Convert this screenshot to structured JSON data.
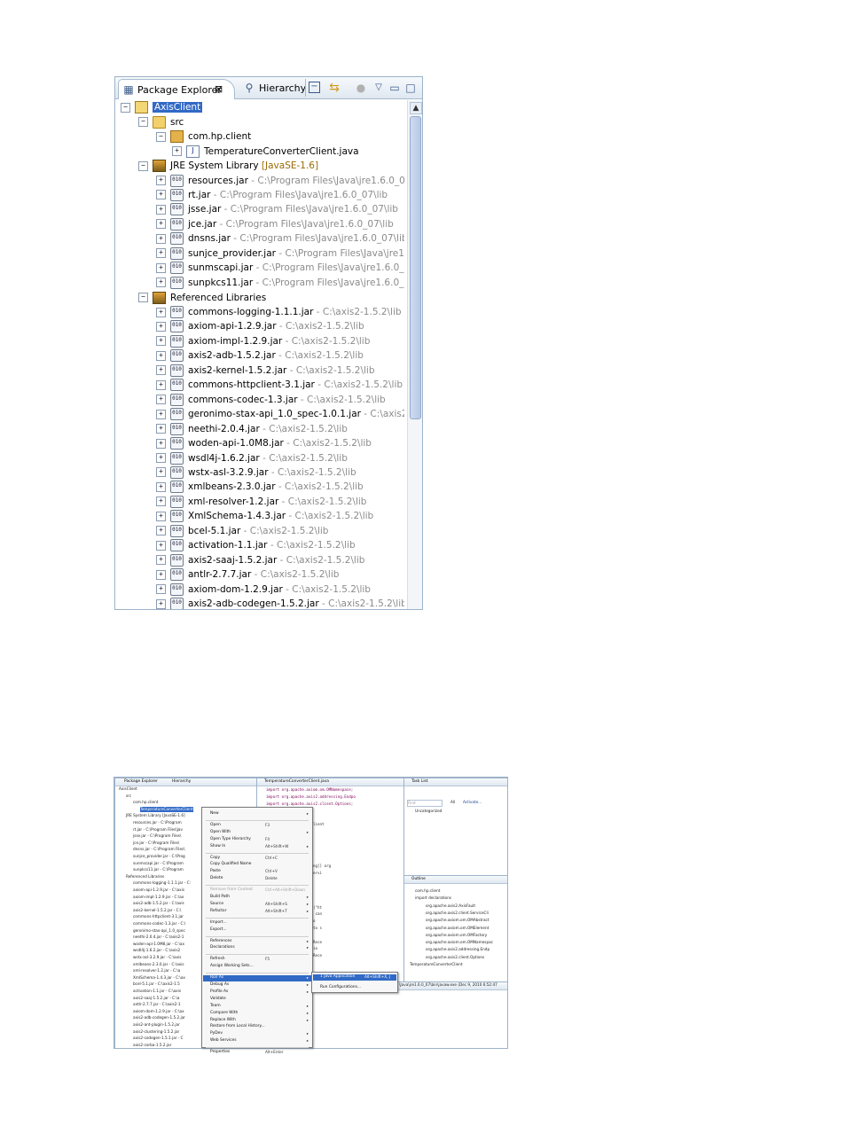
{
  "package_explorer": {
    "tabs": [
      {
        "label": "Package Explorer",
        "close": "⊠"
      },
      {
        "label": "Hierarchy"
      }
    ],
    "tree": {
      "project": "AxisClient",
      "src": "src",
      "package": "com.hp.client",
      "java_file": "TemperatureConverterClient.java",
      "jre_library": {
        "label": "JRE System Library",
        "decoration": "[JavaSE-1.6]"
      },
      "jre_jars": [
        {
          "name": "resources.jar",
          "path": " - C:\\Program Files\\Java\\jre1.6.0_07\\lib"
        },
        {
          "name": "rt.jar",
          "path": " - C:\\Program Files\\Java\\jre1.6.0_07\\lib"
        },
        {
          "name": "jsse.jar",
          "path": " - C:\\Program Files\\Java\\jre1.6.0_07\\lib"
        },
        {
          "name": "jce.jar",
          "path": " - C:\\Program Files\\Java\\jre1.6.0_07\\lib"
        },
        {
          "name": "dnsns.jar",
          "path": " - C:\\Program Files\\Java\\jre1.6.0_07\\lib\\ext"
        },
        {
          "name": "sunjce_provider.jar",
          "path": " - C:\\Program Files\\Java\\jre1.6.0"
        },
        {
          "name": "sunmscapi.jar",
          "path": " - C:\\Program Files\\Java\\jre1.6.0_07\\lib"
        },
        {
          "name": "sunpkcs11.jar",
          "path": " - C:\\Program Files\\Java\\jre1.6.0_07\\lib"
        }
      ],
      "referenced_label": "Referenced Libraries",
      "referenced_jars": [
        {
          "name": "commons-logging-1.1.1.jar",
          "path": " - C:\\axis2-1.5.2\\lib"
        },
        {
          "name": "axiom-api-1.2.9.jar",
          "path": " - C:\\axis2-1.5.2\\lib"
        },
        {
          "name": "axiom-impl-1.2.9.jar",
          "path": " - C:\\axis2-1.5.2\\lib"
        },
        {
          "name": "axis2-adb-1.5.2.jar",
          "path": " - C:\\axis2-1.5.2\\lib"
        },
        {
          "name": "axis2-kernel-1.5.2.jar",
          "path": " - C:\\axis2-1.5.2\\lib"
        },
        {
          "name": "commons-httpclient-3.1.jar",
          "path": " - C:\\axis2-1.5.2\\lib"
        },
        {
          "name": "commons-codec-1.3.jar",
          "path": " - C:\\axis2-1.5.2\\lib"
        },
        {
          "name": "geronimo-stax-api_1.0_spec-1.0.1.jar",
          "path": " - C:\\axis2-1.5"
        },
        {
          "name": "neethi-2.0.4.jar",
          "path": " - C:\\axis2-1.5.2\\lib"
        },
        {
          "name": "woden-api-1.0M8.jar",
          "path": " - C:\\axis2-1.5.2\\lib"
        },
        {
          "name": "wsdl4j-1.6.2.jar",
          "path": " - C:\\axis2-1.5.2\\lib"
        },
        {
          "name": "wstx-asl-3.2.9.jar",
          "path": " - C:\\axis2-1.5.2\\lib"
        },
        {
          "name": "xmlbeans-2.3.0.jar",
          "path": " - C:\\axis2-1.5.2\\lib"
        },
        {
          "name": "xml-resolver-1.2.jar",
          "path": " - C:\\axis2-1.5.2\\lib"
        },
        {
          "name": "XmlSchema-1.4.3.jar",
          "path": " - C:\\axis2-1.5.2\\lib"
        },
        {
          "name": "bcel-5.1.jar",
          "path": " - C:\\axis2-1.5.2\\lib"
        },
        {
          "name": "activation-1.1.jar",
          "path": " - C:\\axis2-1.5.2\\lib"
        },
        {
          "name": "axis2-saaj-1.5.2.jar",
          "path": " - C:\\axis2-1.5.2\\lib"
        },
        {
          "name": "antlr-2.7.7.jar",
          "path": " - C:\\axis2-1.5.2\\lib"
        },
        {
          "name": "axiom-dom-1.2.9.jar",
          "path": " - C:\\axis2-1.5.2\\lib"
        },
        {
          "name": "axis2-adb-codegen-1.5.2.jar",
          "path": " - C:\\axis2-1.5.2\\lib"
        }
      ],
      "jar_badge": "010"
    }
  },
  "workspace": {
    "editor_tab": "TemperatureConverterClient.java",
    "tasklist_tab": "Task List",
    "outline_tab": "Outline",
    "explorer_tab": "Package Explorer",
    "hierarchy_tab": "Hierarchy",
    "code_lines": [
      "import org.apache.axiom.om.OMNamespace;",
      "import org.apache.axis2.addressing.Endpo",
      "import org.apache.axis2.client.Options;",
      "",
      "",
      "TemperatureConverterClient",
      "",
      "",
      "args",
      "AxisFault",
      "",
      "static void main(String[] arg",
      "Client client = new Servi",
      "the option object",
      "g target EPR",
      "opts = new Options();",
      "",
      "new EndpointReference(\"ht",
      "ing action ,and which can",
      "Action(\"urn:fConversio",
      "ing created option into s",
      "setOptions(opts);",
      "nt res1 = client.sendRece",
      "Action(\"urn:fcConversio",
      "nt res2 = client.sendRece",
      "out.println(res1);",
      "out.println(res2);"
    ],
    "tasklist": {
      "find": "Find",
      "all": "All",
      "activate": "Activate...",
      "uncategorized": "Uncategorized"
    },
    "outline_items": [
      "com.hp.client",
      "import declarations",
      "org.apache.axis2.AxisFault",
      "org.apache.axis2.client.ServiceCli",
      "org.apache.axiom.om.OMAbstract",
      "org.apache.axiom.om.OMElement",
      "org.apache.axiom.om.OMFactory",
      "org.apache.axiom.om.OMNamespac",
      "org.apache.axis2.addressing.Endp",
      "org.apache.axis2.client.Options",
      "TemperatureConverterClient"
    ],
    "console_line": "\\Java\\jre1.6.0_07\\bin\\javaw.exe (Dec 9, 2010 6:52:47",
    "mini_tree": {
      "project": "AxisClient",
      "src": "src",
      "package": "com.hp.client",
      "selected": "TemperatureConverterClient",
      "jre": "JRE System Library [JavaSE-1.6]",
      "jre_jars": [
        "resources.jar - C:\\Program",
        "rt.jar - C:\\Program Files\\Jav",
        "jsse.jar - C:\\Program Files\\",
        "jce.jar - C:\\Program Files\\",
        "dnsns.jar - C:\\Program Files\\",
        "sunjce_provider.jar - C:\\Prog",
        "sunmscapi.jar - C:\\Program",
        "sunpkcs11.jar - C:\\Program"
      ],
      "ref": "Referenced Libraries",
      "ref_jars": [
        "commons-logging-1.1.1.jar - C:",
        "axiom-api-1.2.9.jar - C:\\axis",
        "axiom-impl-1.2.9.jar - C:\\ax",
        "axis2-adb-1.5.2.jar - C:\\axis",
        "axis2-kernel-1.5.2.jar - C:\\",
        "commons-httpclient-3.1.jar",
        "commons-codec-1.3.jar - C:\\",
        "geronimo-stax-api_1.0_spec",
        "neethi-2.0.4.jar - C:\\axis2-1",
        "woden-api-1.0M8.jar - C:\\ax",
        "wsdl4j-1.6.2.jar - C:\\axis2",
        "wstx-asl-3.2.9.jar - C:\\axis",
        "xmlbeans-2.3.0.jar - C:\\axis",
        "xml-resolver-1.2.jar - C:\\a",
        "XmlSchema-1.4.3.jar - C:\\ax",
        "bcel-5.1.jar - C:\\axis2-1.5",
        "activation-1.1.jar - C:\\axis",
        "axis2-saaj-1.5.2.jar - C:\\a",
        "antlr-2.7.7.jar - C:\\axis2-1",
        "axiom-dom-1.2.9.jar - C:\\ax",
        "axis2-adb-codegen-1.5.2.jar",
        "axis2-ant-plugin-1.5.2.jar",
        "axis2-clustering-1.5.2.jar",
        "axis2-codegen-1.5.1.jar - C",
        "axis2-corba-1.5.2.jar"
      ]
    },
    "context_menu": [
      {
        "label": "New",
        "submenu": true
      },
      {
        "sep": true
      },
      {
        "label": "Open",
        "shortcut": "F3"
      },
      {
        "label": "Open With",
        "submenu": true
      },
      {
        "label": "Open Type Hierarchy",
        "shortcut": "F4"
      },
      {
        "label": "Show In",
        "shortcut": "Alt+Shift+W",
        "submenu": true
      },
      {
        "sep": true
      },
      {
        "label": "Copy",
        "shortcut": "Ctrl+C"
      },
      {
        "label": "Copy Qualified Name"
      },
      {
        "label": "Paste",
        "shortcut": "Ctrl+V"
      },
      {
        "label": "Delete",
        "shortcut": "Delete"
      },
      {
        "sep": true
      },
      {
        "label": "Remove from Context",
        "shortcut": "Ctrl+Alt+Shift+Down",
        "disabled": true
      },
      {
        "label": "Build Path",
        "submenu": true
      },
      {
        "label": "Source",
        "shortcut": "Alt+Shift+S",
        "submenu": true
      },
      {
        "label": "Refactor",
        "shortcut": "Alt+Shift+T",
        "submenu": true
      },
      {
        "sep": true
      },
      {
        "label": "Import..."
      },
      {
        "label": "Export..."
      },
      {
        "sep": true
      },
      {
        "label": "References",
        "submenu": true
      },
      {
        "label": "Declarations",
        "submenu": true
      },
      {
        "sep": true
      },
      {
        "label": "Refresh",
        "shortcut": "F5"
      },
      {
        "label": "Assign Working Sets..."
      },
      {
        "sep": true
      },
      {
        "label": "Run As",
        "submenu": true,
        "highlight": true
      },
      {
        "label": "Debug As",
        "submenu": true
      },
      {
        "label": "Profile As",
        "submenu": true
      },
      {
        "label": "Validate"
      },
      {
        "label": "Team",
        "submenu": true
      },
      {
        "label": "Compare With",
        "submenu": true
      },
      {
        "label": "Replace With",
        "submenu": true
      },
      {
        "label": "Restore from Local History..."
      },
      {
        "label": "PyDev",
        "submenu": true
      },
      {
        "label": "Web Services",
        "submenu": true
      },
      {
        "sep": true
      },
      {
        "label": "Properties",
        "shortcut": "Alt+Enter"
      }
    ],
    "run_submenu": [
      {
        "label": "1 Java Application",
        "shortcut": "Alt+Shift+X, J",
        "highlight": true
      },
      {
        "label": "Run Configurations..."
      }
    ]
  }
}
